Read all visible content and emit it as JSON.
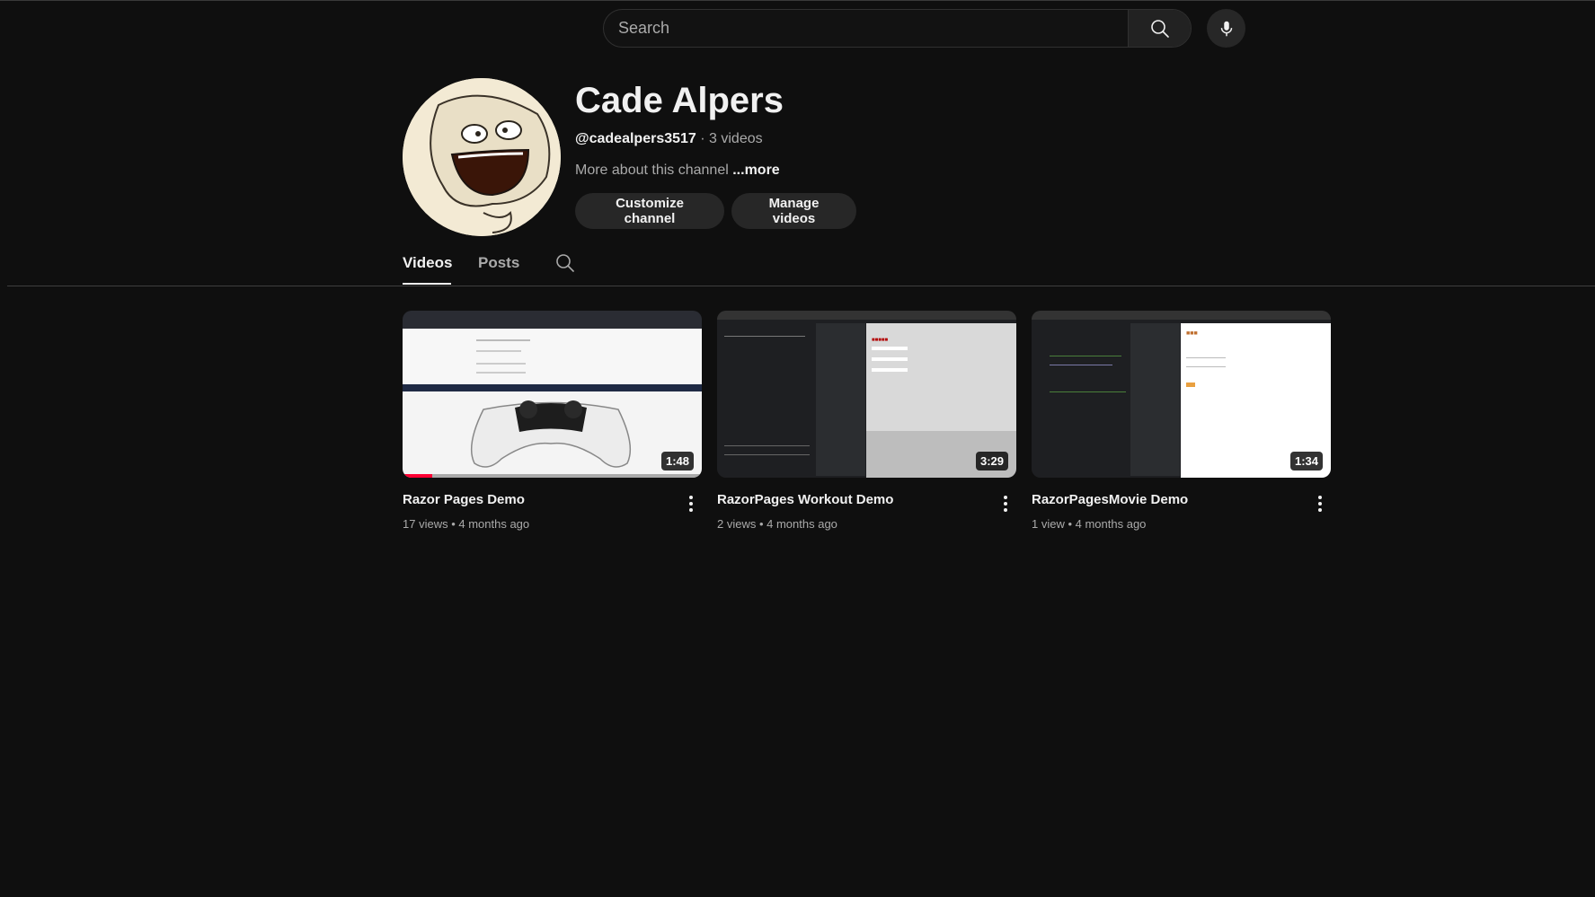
{
  "search": {
    "placeholder": "Search"
  },
  "channel": {
    "name": "Cade Alpers",
    "handle": "@cadealpers3517",
    "separator": " · ",
    "video_count": "3 videos",
    "description": "More about this channel",
    "more_label": "...more",
    "customize_label": "Customize channel",
    "manage_label": "Manage videos"
  },
  "tabs": [
    {
      "label": "Videos",
      "selected": true
    },
    {
      "label": "Posts",
      "selected": false
    }
  ],
  "videos": [
    {
      "title": "Razor Pages Demo",
      "views": "17 views",
      "age": "4 months ago",
      "duration": "1:48",
      "watched_fraction": 0.1
    },
    {
      "title": "RazorPages Workout Demo",
      "views": "2 views",
      "age": "4 months ago",
      "duration": "3:29"
    },
    {
      "title": "RazorPagesMovie Demo",
      "views": "1 view",
      "age": "4 months ago",
      "duration": "1:34"
    }
  ],
  "meta_separator": " • ",
  "colors": {
    "background": "#0f0f0f",
    "accent_progress": "#ff0033",
    "button_bg": "#272727"
  }
}
